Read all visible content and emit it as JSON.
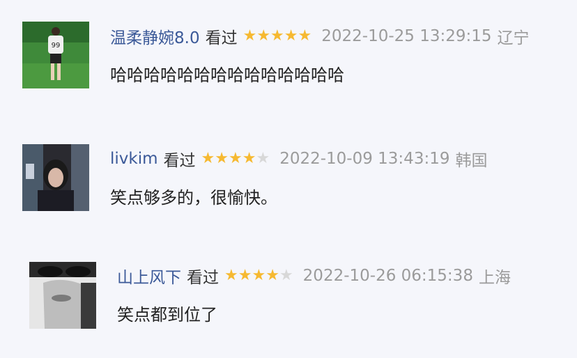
{
  "comments": [
    {
      "username": "温柔静婉8.0",
      "action": "看过",
      "rating": 5,
      "time": "2022-10-25 13:29:15",
      "location": "辽宁",
      "text": "哈哈哈哈哈哈哈哈哈哈哈哈哈哈"
    },
    {
      "username": "livkim",
      "action": "看过",
      "rating": 4,
      "time": "2022-10-09 13:43:19",
      "location": "韩国",
      "text": "笑点够多的，很愉快。"
    },
    {
      "username": "山上风下",
      "action": "看过",
      "rating": 4,
      "time": "2022-10-26 06:15:38",
      "location": "上海",
      "text": "笑点都到位了"
    }
  ]
}
